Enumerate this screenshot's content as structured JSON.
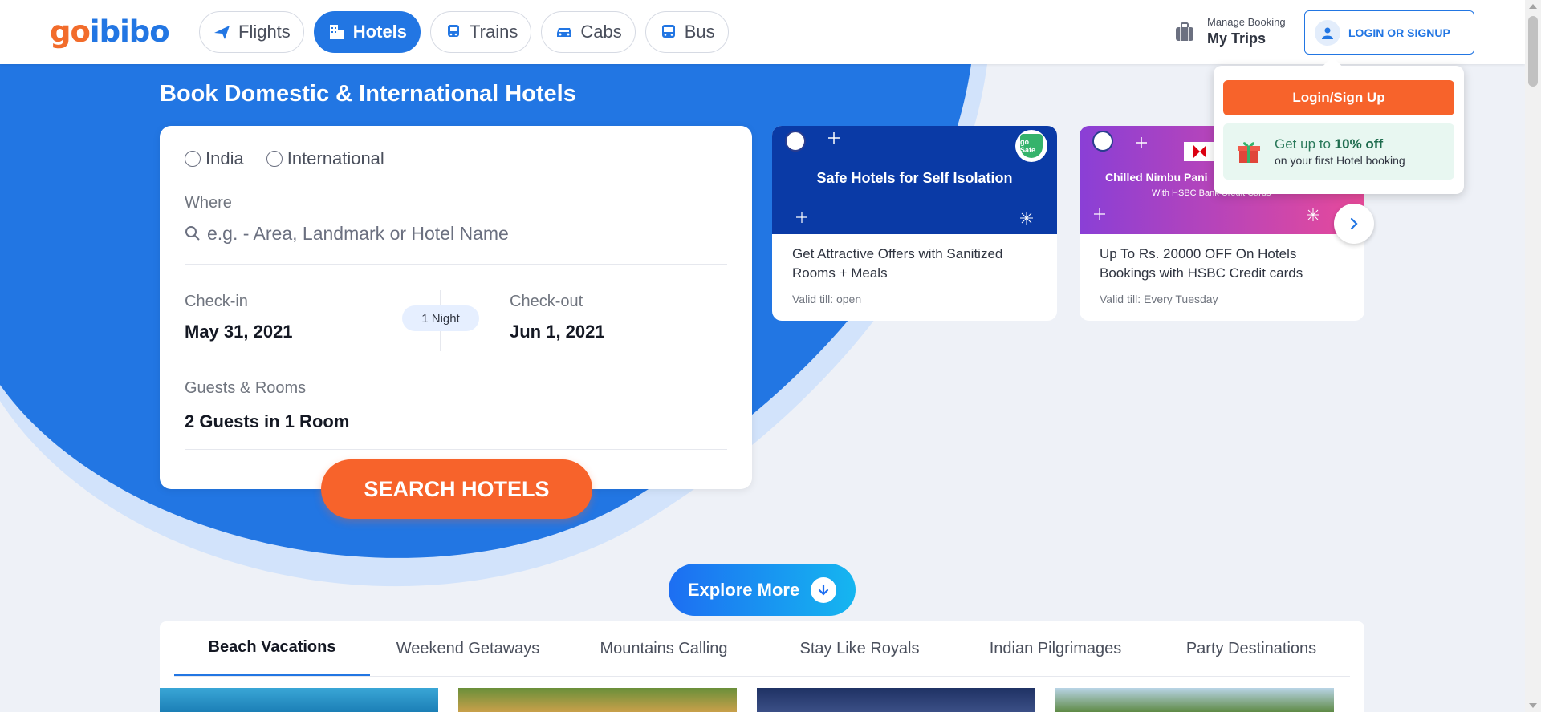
{
  "header": {
    "logo_go": "go",
    "logo_ibibo": "ibibo",
    "tabs": [
      {
        "label": "Flights",
        "icon": "plane-icon"
      },
      {
        "label": "Hotels",
        "icon": "hotel-icon",
        "active": true
      },
      {
        "label": "Trains",
        "icon": "train-icon"
      },
      {
        "label": "Cabs",
        "icon": "car-icon"
      },
      {
        "label": "Bus",
        "icon": "bus-icon"
      }
    ],
    "manage_small": "Manage Booking",
    "manage_big": "My Trips",
    "login_label": "LOGIN OR SIGNUP"
  },
  "hero": {
    "title": "Book Domestic & International Hotels"
  },
  "search": {
    "radio_india": "India",
    "radio_international": "International",
    "where_label": "Where",
    "where_placeholder": "e.g. - Area, Landmark or Hotel Name",
    "checkin_label": "Check-in",
    "checkin_value": "May 31, 2021",
    "nights": "1 Night",
    "checkout_label": "Check-out",
    "checkout_value": "Jun 1, 2021",
    "guests_label": "Guests & Rooms",
    "guests_value": "2 Guests in 1 Room",
    "search_button": "SEARCH HOTELS"
  },
  "offers": [
    {
      "banner": "Safe Hotels for Self Isolation",
      "badge": "go Safe",
      "text": "Get Attractive Offers with Sanitized Rooms + Meals",
      "valid": "Valid till: open",
      "color": "#0a3aa6"
    },
    {
      "banner": "Chilled Nimbu Pani",
      "sub": "With HSBC Bank Credit Cards",
      "text": "Up To Rs. 20000 OFF On Hotels Bookings with HSBC Credit cards",
      "valid": "Valid till: Every Tuesday",
      "color": "#8a3fd6"
    }
  ],
  "popup": {
    "button": "Login/Sign Up",
    "line1_prefix": "Get up to",
    "line1_highlight": "10% off",
    "line2": "on your first Hotel booking"
  },
  "explore": {
    "label": "Explore More"
  },
  "bottom_tabs": [
    "Beach Vacations",
    "Weekend Getaways",
    "Mountains Calling",
    "Stay Like Royals",
    "Indian Pilgrimages",
    "Party Destinations"
  ],
  "colors": {
    "brand_blue": "#2276e3",
    "brand_orange": "#f7632b",
    "bg": "#eef1f7"
  }
}
